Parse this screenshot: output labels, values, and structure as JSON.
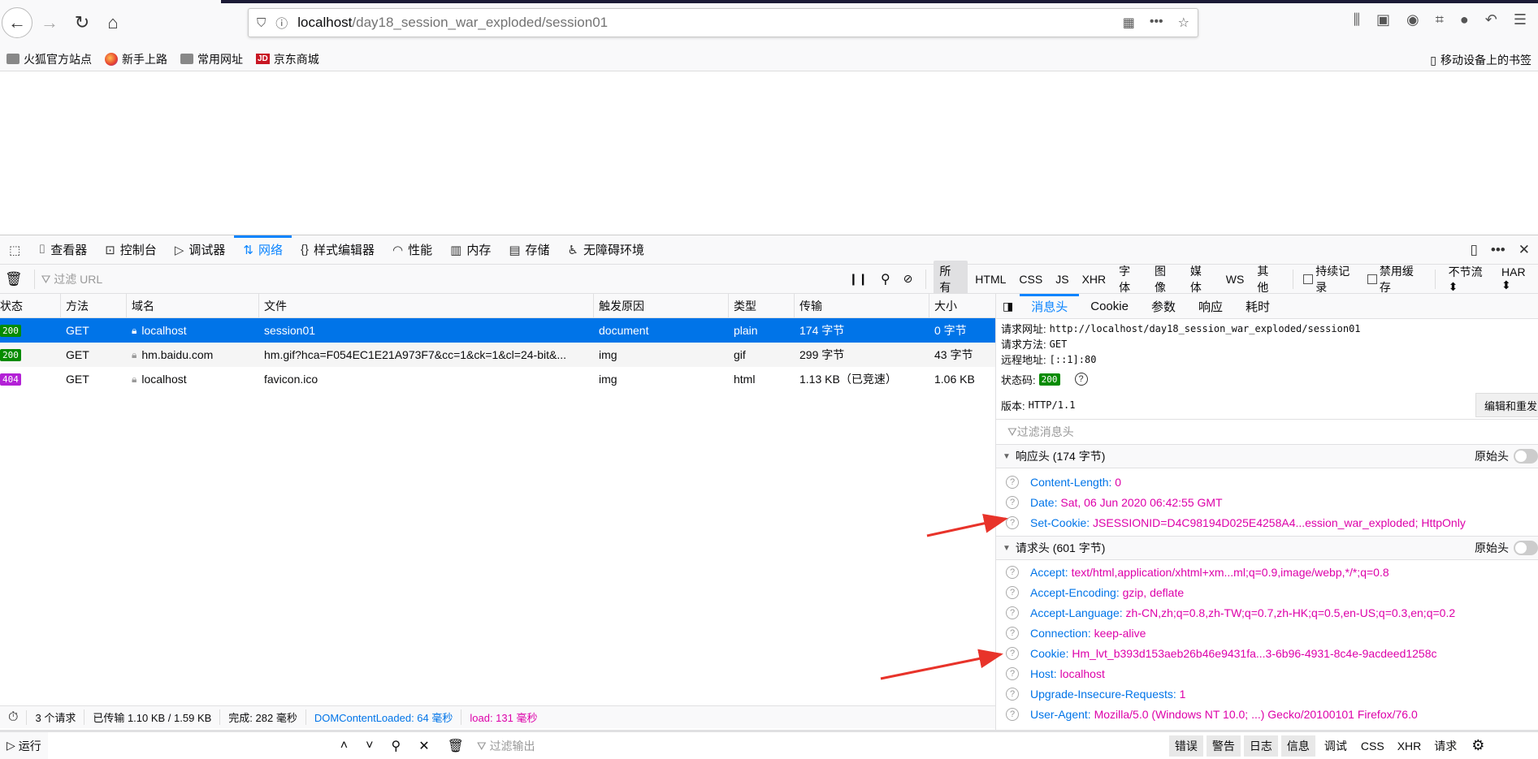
{
  "browser": {
    "url_host": "localhost",
    "url_path": "/day18_session_war_exploded/session01",
    "bookmarks": [
      "火狐官方站点",
      "新手上路",
      "常用网址",
      "京东商城"
    ],
    "mobile_bookmarks": "移动设备上的书签"
  },
  "devtools": {
    "tabs": [
      "查看器",
      "控制台",
      "调试器",
      "网络",
      "样式编辑器",
      "性能",
      "内存",
      "存储",
      "无障碍环境"
    ],
    "selected_tab": "网络",
    "filter_placeholder": "过滤 URL",
    "type_filters": [
      "所有",
      "HTML",
      "CSS",
      "JS",
      "XHR",
      "字体",
      "图像",
      "媒体",
      "WS",
      "其他"
    ],
    "persist_logs": "持续记录",
    "disable_cache": "禁用缓存",
    "throttle": "不节流 ⬍",
    "har": "HAR ⬍",
    "columns": [
      "状态",
      "方法",
      "域名",
      "文件",
      "触发原因",
      "类型",
      "传输",
      "大小"
    ],
    "requests": [
      {
        "status": "200",
        "method": "GET",
        "domain": "localhost",
        "file": "session01",
        "cause": "document",
        "type": "plain",
        "transferred": "174 字节",
        "size": "0 字节"
      },
      {
        "status": "200",
        "method": "GET",
        "domain": "hm.baidu.com",
        "file": "hm.gif?hca=F054EC1E21A973F7&cc=1&ck=1&cl=24-bit&...",
        "cause": "img",
        "type": "gif",
        "transferred": "299 字节",
        "size": "43 字节"
      },
      {
        "status": "404",
        "method": "GET",
        "domain": "localhost",
        "file": "favicon.ico",
        "cause": "img",
        "type": "html",
        "transferred": "1.13 KB（已竞速）",
        "size": "1.06 KB"
      }
    ],
    "statusbar": {
      "requests": "3 个请求",
      "transferred": "已传输 1.10 KB / 1.59 KB",
      "finish": "完成:  282 毫秒",
      "dcl": "DOMContentLoaded: 64 毫秒",
      "load": "load: 131 毫秒"
    },
    "details": {
      "tabs": [
        "消息头",
        "Cookie",
        "参数",
        "响应",
        "耗时"
      ],
      "request_url_label": "请求网址:",
      "request_url": "http://localhost/day18_session_war_exploded/session01",
      "method_label": "请求方法:",
      "method": "GET",
      "remote_label": "远程地址:",
      "remote": "[::1]:80",
      "status_label": "状态码:",
      "status": "200",
      "version_label": "版本:",
      "version": "HTTP/1.1",
      "edit_resend": "编辑和重发",
      "filter_headers_placeholder": "过滤消息头",
      "raw_label": "原始头",
      "response_section": "响应头 (174 字节)",
      "response_headers": [
        {
          "name": "Content-Length:",
          "value": "0"
        },
        {
          "name": "Date:",
          "value": "Sat, 06 Jun 2020 06:42:55 GMT"
        },
        {
          "name": "Set-Cookie:",
          "value": "JSESSIONID=D4C98194D025E4258A4...ession_war_exploded; HttpOnly"
        }
      ],
      "request_section": "请求头 (601 字节)",
      "request_headers": [
        {
          "name": "Accept:",
          "value": "text/html,application/xhtml+xm...ml;q=0.9,image/webp,*/*;q=0.8"
        },
        {
          "name": "Accept-Encoding:",
          "value": "gzip, deflate"
        },
        {
          "name": "Accept-Language:",
          "value": "zh-CN,zh;q=0.8,zh-TW;q=0.7,zh-HK;q=0.5,en-US;q=0.3,en;q=0.2"
        },
        {
          "name": "Connection:",
          "value": "keep-alive"
        },
        {
          "name": "Cookie:",
          "value": "Hm_lvt_b393d153aeb26b46e9431fa...3-6b96-4931-8c4e-9acdeed1258c"
        },
        {
          "name": "Host:",
          "value": "localhost"
        },
        {
          "name": "Upgrade-Insecure-Requests:",
          "value": "1"
        },
        {
          "name": "User-Agent:",
          "value": "Mozilla/5.0 (Windows NT 10.0; ...) Gecko/20100101 Firefox/76.0"
        }
      ]
    },
    "console": {
      "run": "运行",
      "filter_placeholder": "过滤输出",
      "levels": [
        "错误",
        "警告",
        "日志",
        "信息",
        "调试"
      ],
      "extra": [
        "CSS",
        "XHR",
        "请求"
      ]
    }
  },
  "colors": {
    "accent": "#0a84ff",
    "selected_row": "#0074e8",
    "status_ok": "#058b00",
    "status_404": "#b321d6",
    "header_name": "#0074e8",
    "header_value": "#dd00a9",
    "annotation_arrow": "#e8332a"
  }
}
